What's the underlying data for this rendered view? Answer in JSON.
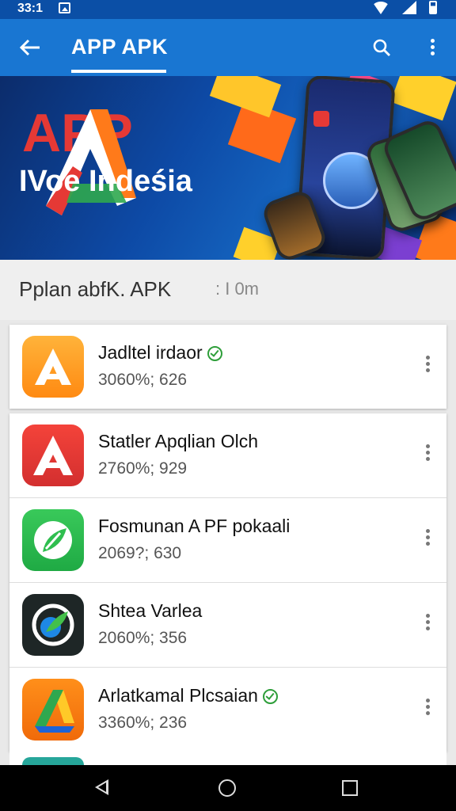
{
  "status_bar": {
    "time": "33:1"
  },
  "app_bar": {
    "title": "APP APK",
    "back_icon": "arrow-back-icon",
    "search_icon": "search-icon",
    "more_icon": "more-vert-icon"
  },
  "banner": {
    "title": "APP",
    "subtitle": "IVoe Indeśia"
  },
  "section": {
    "title": "Pplan abfK. APK",
    "meta": ": I 0m"
  },
  "apps": [
    {
      "name": "Jadltel irdaor",
      "meta": "3060%; 626",
      "verified": true,
      "icon_color": "#ff9e20",
      "icon_name": "orange-a-app-icon"
    },
    {
      "name": "Statler Apqlian Olch",
      "meta": "2760%; 929",
      "verified": false,
      "icon_color": "#e53935",
      "icon_name": "red-a-app-icon"
    },
    {
      "name": "Fosmunan A PF pokaali",
      "meta": "2069?; 630",
      "verified": false,
      "icon_color": "#2fbe4f",
      "icon_name": "green-leaf-app-icon"
    },
    {
      "name": "Shtea Varlea",
      "meta": "2060%; 356",
      "verified": false,
      "icon_color": "#1f2a2a",
      "icon_name": "dark-globe-app-icon"
    },
    {
      "name": "Arlatkamal Plcsaian",
      "meta": "3360%; 236",
      "verified": true,
      "icon_color": "#f57c00",
      "icon_name": "drive-app-icon"
    }
  ],
  "nav": {
    "back": "nav-back-icon",
    "home": "nav-home-icon",
    "recent": "nav-recent-icon"
  }
}
